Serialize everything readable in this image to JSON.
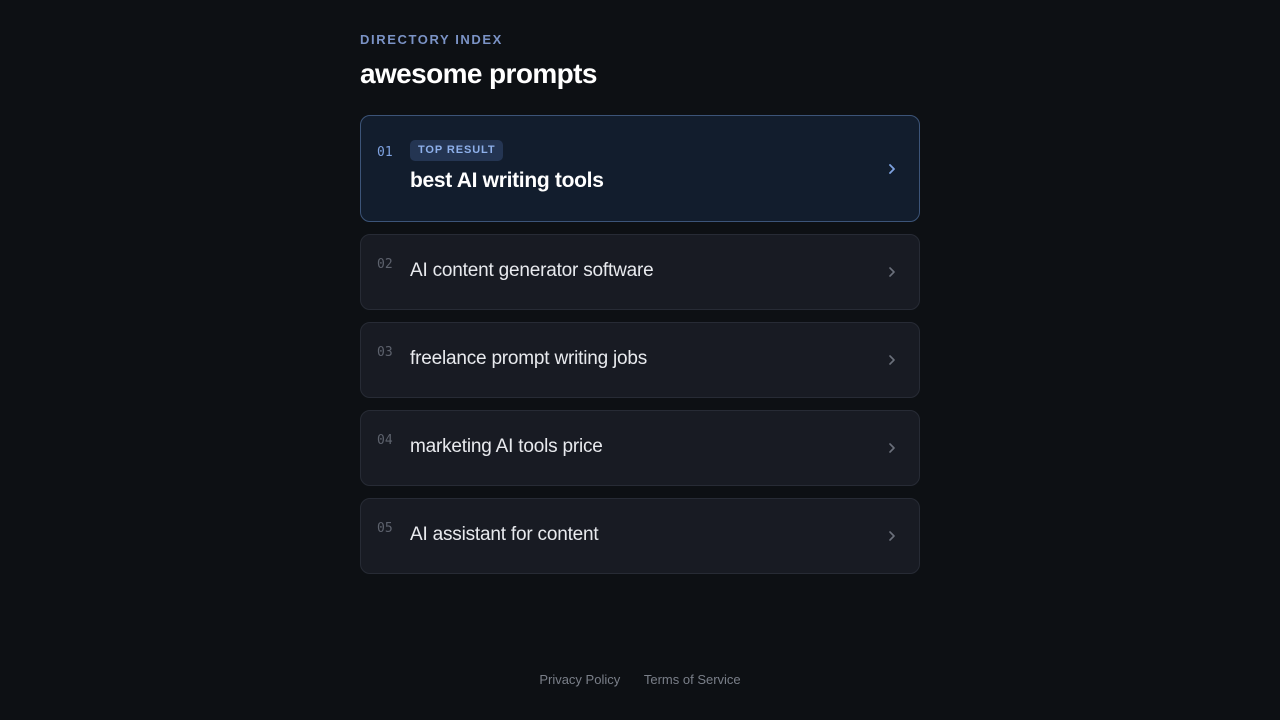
{
  "header": {
    "eyebrow": "DIRECTORY INDEX",
    "title": "awesome prompts"
  },
  "results": [
    {
      "number": "01",
      "badge": "TOP RESULT",
      "label": "best AI writing tools",
      "top": true
    },
    {
      "number": "02",
      "label": "AI content generator software"
    },
    {
      "number": "03",
      "label": "freelance prompt writing jobs"
    },
    {
      "number": "04",
      "label": "marketing AI tools price"
    },
    {
      "number": "05",
      "label": "AI assistant for content"
    }
  ],
  "footer": {
    "privacy": "Privacy Policy",
    "terms": "Terms of Service"
  },
  "colors": {
    "background": "#0d1014",
    "accent": "#7ea2e0",
    "card": "#181b23",
    "top_card": "#121d2d"
  },
  "icons": {
    "row_arrow": "chevron-right-icon"
  }
}
